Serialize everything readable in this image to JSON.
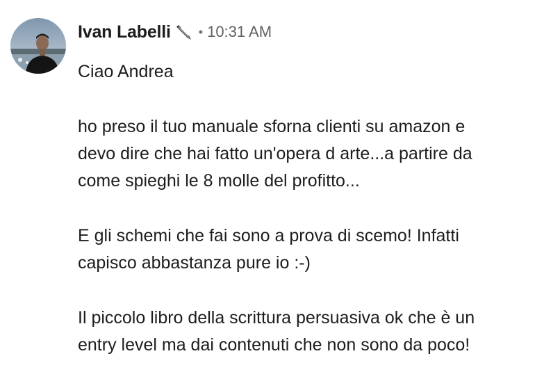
{
  "message": {
    "author": "Ivan Labelli",
    "status_icon": "feather-pen-icon",
    "separator": "•",
    "time": "10:31 AM",
    "paragraphs": [
      [
        "Ciao Andrea"
      ],
      [
        "ho preso il tuo manuale sforna clienti su amazon e",
        "devo dire che hai fatto un'opera d arte...a partire da",
        "come spieghi le 8 molle del profitto..."
      ],
      [
        "E gli schemi che fai sono a prova di scemo! Infatti",
        "capisco abbastanza pure io :-)"
      ],
      [
        "Il piccolo libro della scrittura persuasiva ok che è un",
        "entry level ma dai contenuti che non sono da poco!"
      ]
    ]
  }
}
